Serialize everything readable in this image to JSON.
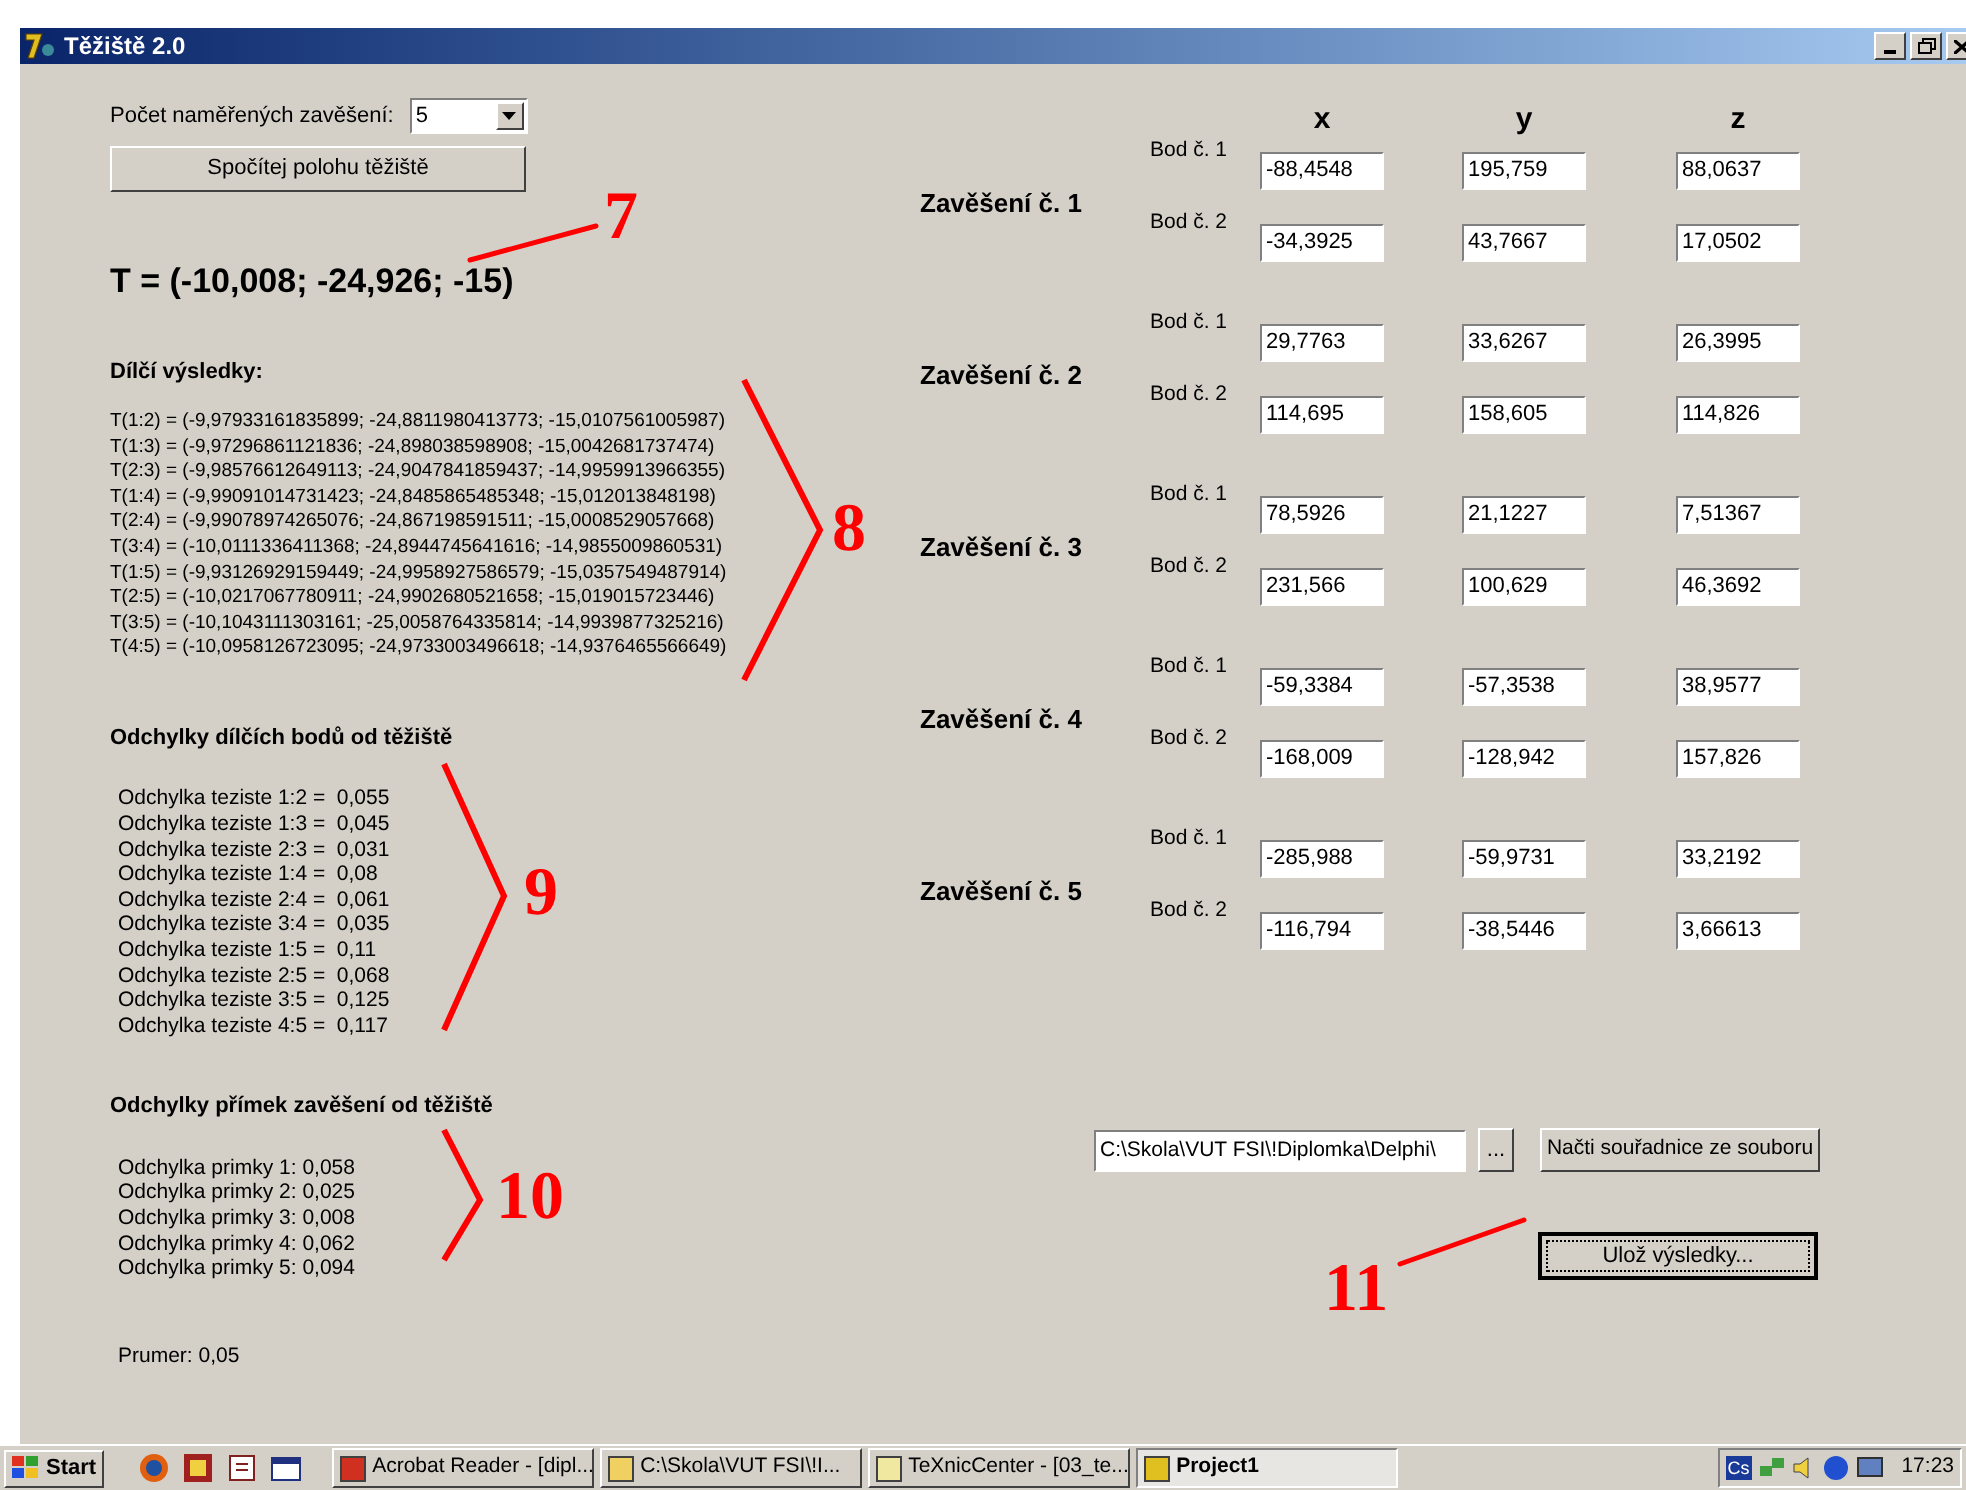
{
  "window": {
    "title": "Těžiště 2.0"
  },
  "count_label": "Počet naměřených zavěšení:",
  "count_select": {
    "value": "5"
  },
  "compute_button": "Spočítej polohu těžiště",
  "result": "T = (-10,008; -24,926; -15)",
  "partial_heading": "Dílčí výsledky:",
  "partial_results": [
    "T(1:2) = (-9,97933161835899; -24,8811980413773; -15,0107561005987)",
    "T(1:3) = (-9,97296861121836; -24,898038598908; -15,0042681737474)",
    "T(2:3) = (-9,98576612649113; -24,9047841859437; -14,9959913966355)",
    "T(1:4) = (-9,99091014731423; -24,8485865485348; -15,012013848198)",
    "T(2:4) = (-9,99078974265076; -24,867198591511; -15,0008529057668)",
    "T(3:4) = (-10,0111336411368; -24,8944745641616; -14,9855009860531)",
    "T(1:5) = (-9,93126929159449; -24,9958927586579; -15,0357549487914)",
    "T(2:5) = (-10,0217067780911; -24,9902680521658; -15,019015723446)",
    "T(3:5) = (-10,1043111303161; -25,0058764335814; -14,9939877325216)",
    "T(4:5) = (-10,0958126723095; -24,9733003496618; -14,9376465566649)"
  ],
  "point_dev_heading": "Odchylky dílčích bodů od těžiště",
  "point_deviations": [
    "Odchylka teziste 1:2 =  0,055",
    "Odchylka teziste 1:3 =  0,045",
    "Odchylka teziste 2:3 =  0,031",
    "Odchylka teziste 1:4 =  0,08",
    "Odchylka teziste 2:4 =  0,061",
    "Odchylka teziste 3:4 =  0,035",
    "Odchylka teziste 1:5 =  0,11",
    "Odchylka teziste 2:5 =  0,068",
    "Odchylka teziste 3:5 =  0,125",
    "Odchylka teziste 4:5 =  0,117"
  ],
  "line_dev_heading": "Odchylky přímek zavěšení od těžiště",
  "line_deviations": [
    "Odchylka primky 1: 0,058",
    "Odchylka primky 2: 0,025",
    "Odchylka primky 3: 0,008",
    "Odchylka primky 4: 0,062",
    "Odchylka primky 5: 0,094"
  ],
  "average": "Prumer: 0,05",
  "columns": [
    "x",
    "y",
    "z"
  ],
  "suspensions": [
    {
      "label": "Zavěšení č. 1",
      "points": [
        {
          "label": "Bod č. 1",
          "values": [
            "-88,4548",
            "195,759",
            "88,0637"
          ]
        },
        {
          "label": "Bod č. 2",
          "values": [
            "-34,3925",
            "43,7667",
            "17,0502"
          ]
        }
      ]
    },
    {
      "label": "Zavěšení č. 2",
      "points": [
        {
          "label": "Bod č. 1",
          "values": [
            "29,7763",
            "33,6267",
            "26,3995"
          ]
        },
        {
          "label": "Bod č. 2",
          "values": [
            "114,695",
            "158,605",
            "114,826"
          ]
        }
      ]
    },
    {
      "label": "Zavěšení č. 3",
      "points": [
        {
          "label": "Bod č. 1",
          "values": [
            "78,5926",
            "21,1227",
            "7,51367"
          ]
        },
        {
          "label": "Bod č. 2",
          "values": [
            "231,566",
            "100,629",
            "46,3692"
          ]
        }
      ]
    },
    {
      "label": "Zavěšení č. 4",
      "points": [
        {
          "label": "Bod č. 1",
          "values": [
            "-59,3384",
            "-57,3538",
            "38,9577"
          ]
        },
        {
          "label": "Bod č. 2",
          "values": [
            "-168,009",
            "-128,942",
            "157,826"
          ]
        }
      ]
    },
    {
      "label": "Zavěšení č. 5",
      "points": [
        {
          "label": "Bod č. 1",
          "values": [
            "-285,988",
            "-59,9731",
            "33,2192"
          ]
        },
        {
          "label": "Bod č. 2",
          "values": [
            "-116,794",
            "-38,5446",
            "3,66613"
          ]
        }
      ]
    }
  ],
  "file_path": "C:\\Skola\\VUT FSI\\!Diplomka\\Delphi\\",
  "browse_button": "...",
  "load_button": "Načti souřadnice ze souboru",
  "save_button": {
    "label": "Ulož výsledky...",
    "focused": true
  },
  "annotations": [
    {
      "label": "7",
      "kind": "leader"
    },
    {
      "label": "8",
      "kind": "bracket"
    },
    {
      "label": "9",
      "kind": "bracket"
    },
    {
      "label": "10",
      "kind": "bracket"
    },
    {
      "label": "11",
      "kind": "leader"
    }
  ],
  "taskbar": {
    "start": "Start",
    "tasks": [
      {
        "label": "Acrobat Reader - [dipl...",
        "selected": false
      },
      {
        "label": "C:\\Skola\\VUT FSI\\!I...",
        "selected": false
      },
      {
        "label": "TeXnicCenter - [03_te...",
        "selected": false
      },
      {
        "label": "Project1",
        "selected": true
      }
    ],
    "tray_badge": "Cs",
    "clock": "17:23"
  }
}
